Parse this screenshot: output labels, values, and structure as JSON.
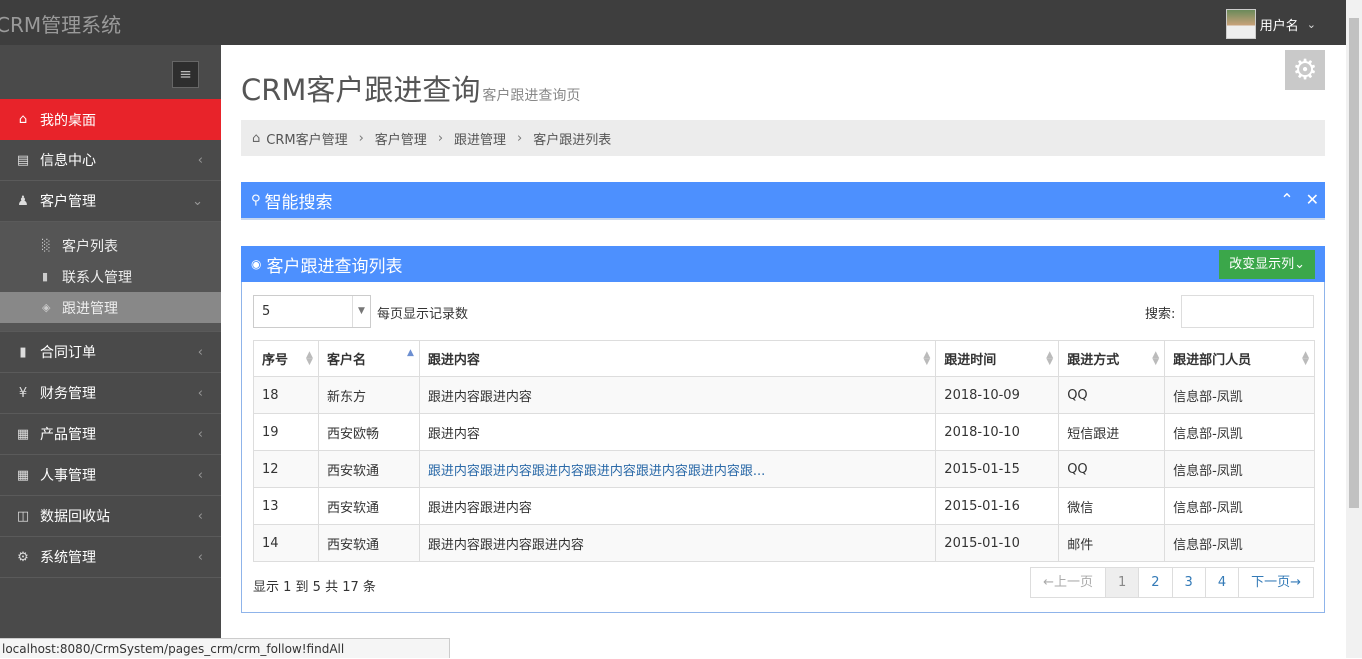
{
  "app": {
    "title": "CRM管理系统",
    "user_name": "用户名"
  },
  "sidebar": {
    "items": [
      {
        "label": "我的桌面",
        "icon": "home-icon",
        "active": true
      },
      {
        "label": "信息中心",
        "icon": "newspaper-icon"
      },
      {
        "label": "客户管理",
        "icon": "person-icon",
        "expanded": true
      },
      {
        "label": "合同订单",
        "icon": "book-icon"
      },
      {
        "label": "财务管理",
        "icon": "yen-icon"
      },
      {
        "label": "产品管理",
        "icon": "table-icon"
      },
      {
        "label": "人事管理",
        "icon": "table-icon"
      },
      {
        "label": "数据回收站",
        "icon": "trash-icon"
      },
      {
        "label": "系统管理",
        "icon": "gear-icon"
      }
    ],
    "sub_items": [
      {
        "label": "客户列表"
      },
      {
        "label": "联系人管理"
      },
      {
        "label": "跟进管理",
        "active": true
      }
    ]
  },
  "page": {
    "title": "CRM客户跟进查询",
    "subtitle": "客户跟进查询页"
  },
  "breadcrumb": [
    "CRM客户管理",
    "客户管理",
    "跟进管理",
    "客户跟进列表"
  ],
  "search_panel": {
    "title": "智能搜索"
  },
  "list_panel": {
    "title": "客户跟进查询列表",
    "change_columns_label": "改变显示列",
    "page_length": "5",
    "page_length_label": "每页显示记录数",
    "search_label": "搜索:",
    "search_value": "",
    "columns": [
      "序号",
      "客户名",
      "跟进内容",
      "跟进时间",
      "跟进方式",
      "跟进部门人员"
    ],
    "rows": [
      [
        "18",
        "新东方",
        "跟进内容跟进内容",
        "2018-10-09",
        "QQ",
        "信息部-凤凯"
      ],
      [
        "19",
        "西安欧畅",
        "跟进内容",
        "2018-10-10",
        "短信跟进",
        "信息部-凤凯"
      ],
      [
        "12",
        "西安软通",
        "跟进内容跟进内容跟进内容跟进内容跟进内容跟进内容跟...",
        "2015-01-15",
        "QQ",
        "信息部-凤凯"
      ],
      [
        "13",
        "西安软通",
        "跟进内容跟进内容",
        "2015-01-16",
        "微信",
        "信息部-凤凯"
      ],
      [
        "14",
        "西安软通",
        "跟进内容跟进内容跟进内容",
        "2015-01-10",
        "邮件",
        "信息部-凤凯"
      ]
    ],
    "info": "显示 1 到 5 共 17 条",
    "pager": {
      "prev": "←上一页",
      "pages": [
        "1",
        "2",
        "3",
        "4"
      ],
      "current": "1",
      "next": "下一页→"
    }
  },
  "status_bar": "localhost:8080/CrmSystem/pages_crm/crm_follow!findAll",
  "colors": {
    "accent_red": "#e8232a",
    "panel_blue": "#4d90fe",
    "button_green": "#3ba74a",
    "topbar": "#3e3e3e",
    "sidebar": "#4a4a4a"
  }
}
